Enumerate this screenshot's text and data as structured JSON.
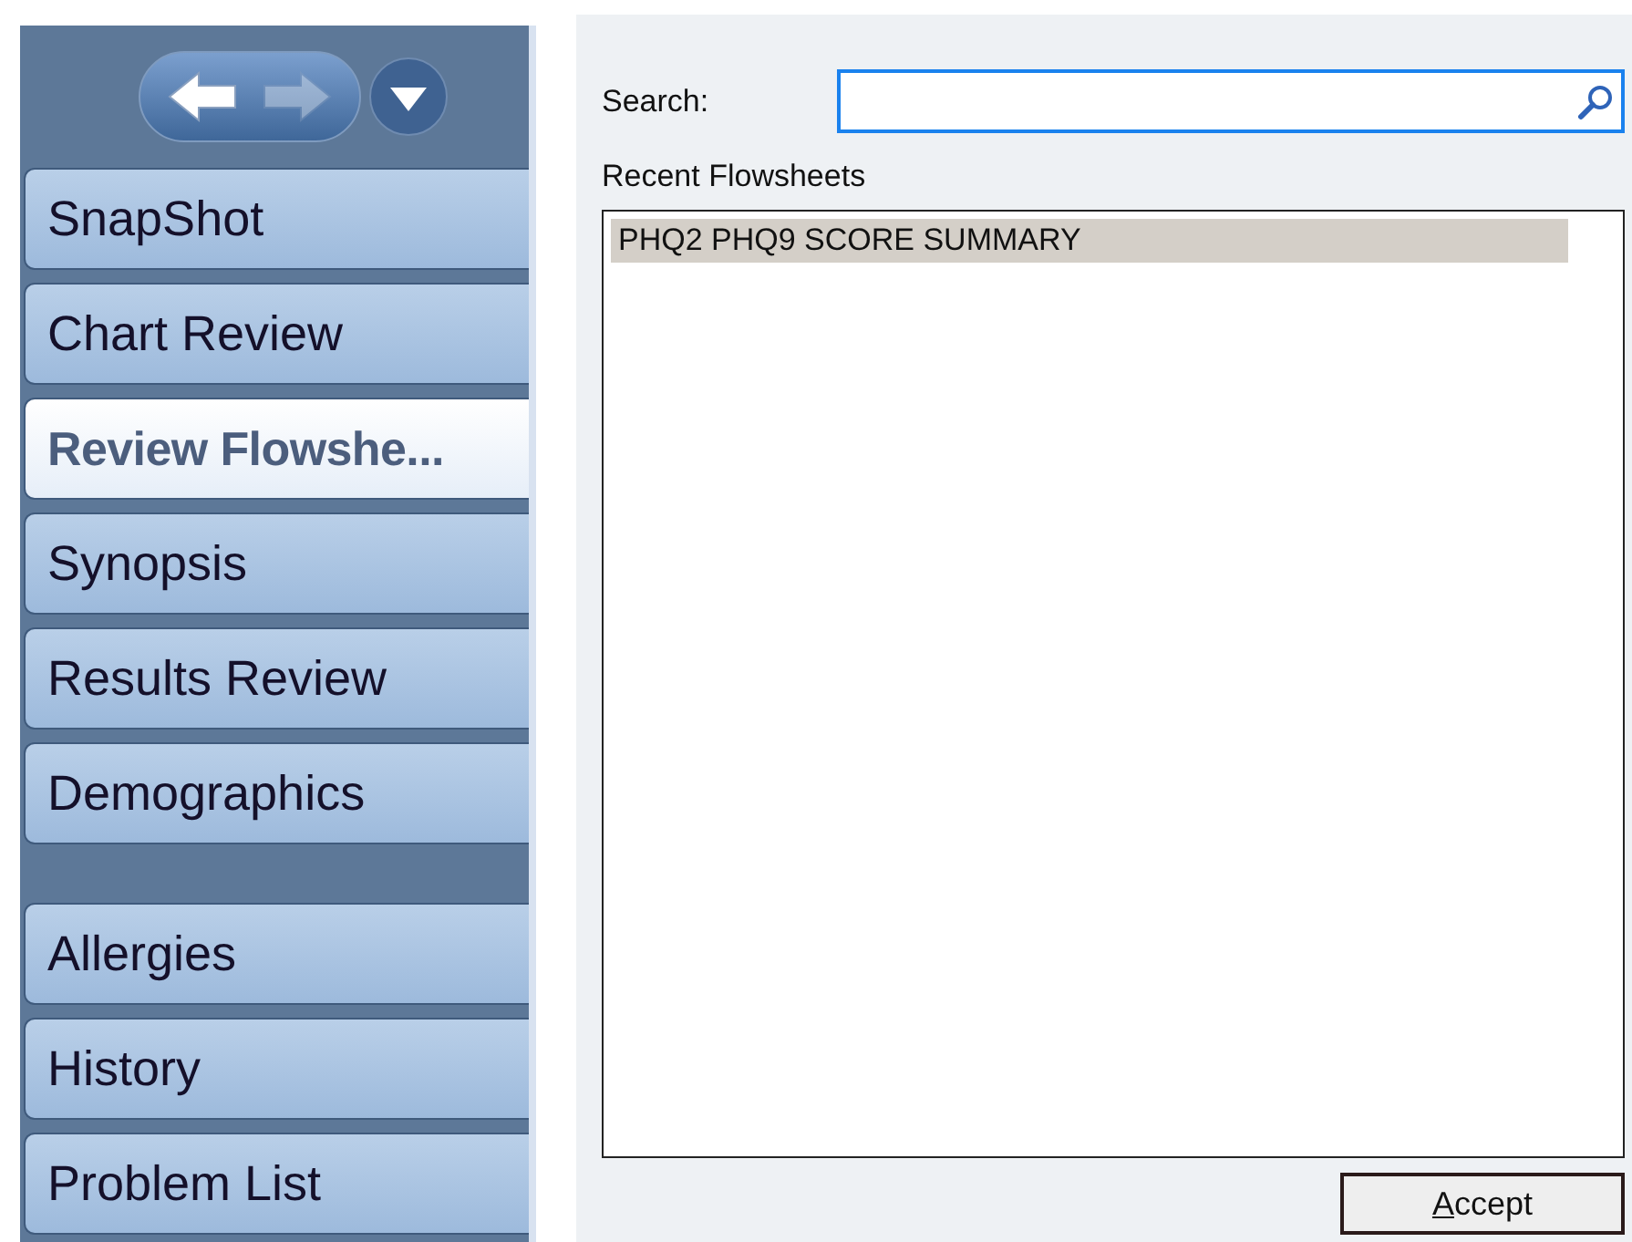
{
  "sidebar": {
    "nav": {
      "back_enabled": true,
      "forward_enabled": false
    },
    "groups": [
      [
        {
          "label": "SnapShot",
          "selected": false
        },
        {
          "label": "Chart Review",
          "selected": false
        },
        {
          "label": "Review Flowshe...",
          "selected": true
        },
        {
          "label": "Synopsis",
          "selected": false
        },
        {
          "label": "Results Review",
          "selected": false
        },
        {
          "label": "Demographics",
          "selected": false
        }
      ],
      [
        {
          "label": "Allergies",
          "selected": false
        },
        {
          "label": "History",
          "selected": false
        },
        {
          "label": "Problem List",
          "selected": false
        }
      ]
    ]
  },
  "search": {
    "label": "Search:"
  },
  "recent": {
    "title": "Recent Flowsheets",
    "items": [
      {
        "label": "PHQ2 PHQ9 SCORE SUMMARY",
        "selected": true
      }
    ]
  },
  "accept_button": {
    "accesskey": "A",
    "rest": "ccept"
  }
}
